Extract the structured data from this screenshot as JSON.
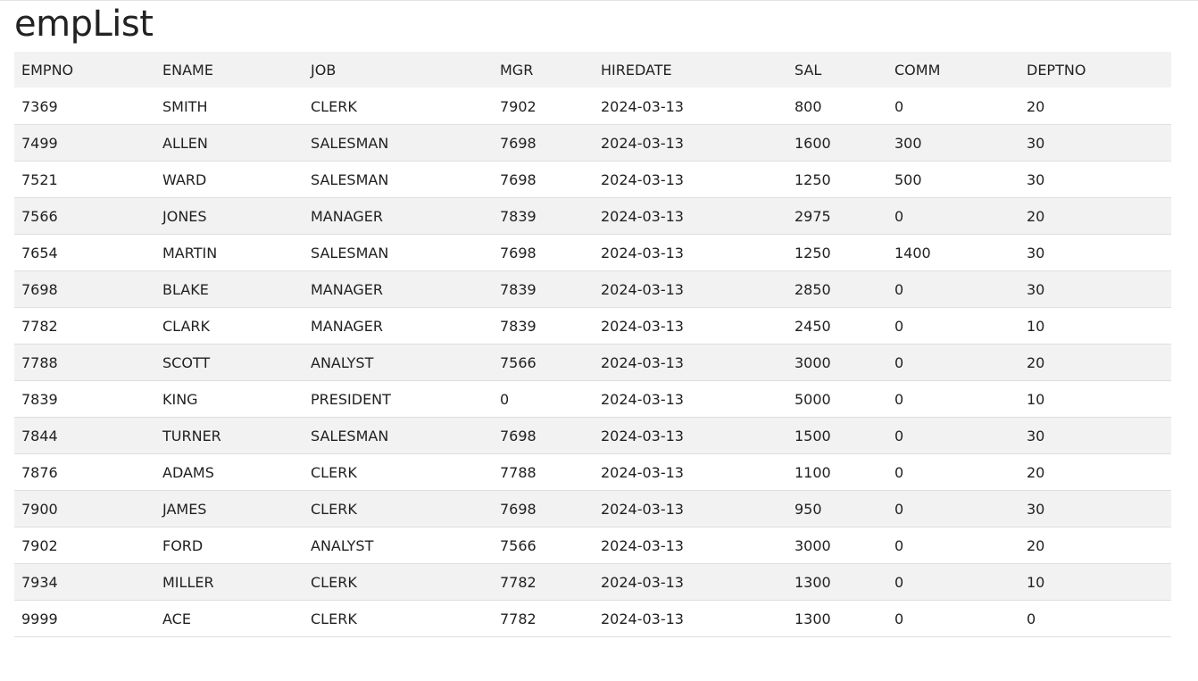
{
  "page": {
    "title": "empList"
  },
  "table": {
    "columns": [
      "EMPNO",
      "ENAME",
      "JOB",
      "MGR",
      "HIREDATE",
      "SAL",
      "COMM",
      "DEPTNO"
    ],
    "rows": [
      [
        "7369",
        "SMITH",
        "CLERK",
        "7902",
        "2024-03-13",
        "800",
        "0",
        "20"
      ],
      [
        "7499",
        "ALLEN",
        "SALESMAN",
        "7698",
        "2024-03-13",
        "1600",
        "300",
        "30"
      ],
      [
        "7521",
        "WARD",
        "SALESMAN",
        "7698",
        "2024-03-13",
        "1250",
        "500",
        "30"
      ],
      [
        "7566",
        "JONES",
        "MANAGER",
        "7839",
        "2024-03-13",
        "2975",
        "0",
        "20"
      ],
      [
        "7654",
        "MARTIN",
        "SALESMAN",
        "7698",
        "2024-03-13",
        "1250",
        "1400",
        "30"
      ],
      [
        "7698",
        "BLAKE",
        "MANAGER",
        "7839",
        "2024-03-13",
        "2850",
        "0",
        "30"
      ],
      [
        "7782",
        "CLARK",
        "MANAGER",
        "7839",
        "2024-03-13",
        "2450",
        "0",
        "10"
      ],
      [
        "7788",
        "SCOTT",
        "ANALYST",
        "7566",
        "2024-03-13",
        "3000",
        "0",
        "20"
      ],
      [
        "7839",
        "KING",
        "PRESIDENT",
        "0",
        "2024-03-13",
        "5000",
        "0",
        "10"
      ],
      [
        "7844",
        "TURNER",
        "SALESMAN",
        "7698",
        "2024-03-13",
        "1500",
        "0",
        "30"
      ],
      [
        "7876",
        "ADAMS",
        "CLERK",
        "7788",
        "2024-03-13",
        "1100",
        "0",
        "20"
      ],
      [
        "7900",
        "JAMES",
        "CLERK",
        "7698",
        "2024-03-13",
        "950",
        "0",
        "30"
      ],
      [
        "7902",
        "FORD",
        "ANALYST",
        "7566",
        "2024-03-13",
        "3000",
        "0",
        "20"
      ],
      [
        "7934",
        "MILLER",
        "CLERK",
        "7782",
        "2024-03-13",
        "1300",
        "0",
        "10"
      ],
      [
        "9999",
        "ACE",
        "CLERK",
        "7782",
        "2024-03-13",
        "1300",
        "0",
        "0"
      ]
    ]
  }
}
